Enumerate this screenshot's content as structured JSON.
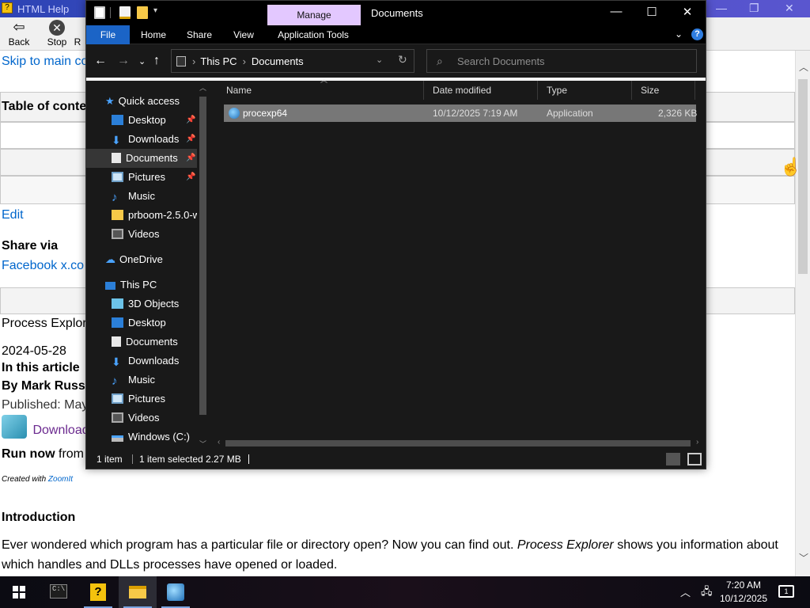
{
  "help_window": {
    "title": "HTML Help",
    "toolbar": {
      "back_label": "Back",
      "stop_label": "Stop",
      "next_partial_label": "R"
    },
    "content": {
      "skip_link": "Skip to main co",
      "toc_heading": "Table of conte",
      "edit_link": "Edit",
      "share_via": "Share via",
      "share_links": "Facebook x.co",
      "article_title": "Process Explor",
      "date": "2024-05-28",
      "in_this_article": "In this article",
      "by_line": "By Mark Russin",
      "published": "Published: May",
      "download_link": "Download",
      "run_now": "Run now",
      "run_now_suffix": "from",
      "created_with": "Created with",
      "zoomit": "ZoomIt",
      "intro_heading": "Introduction",
      "intro_line1_a": "Ever wondered which program has a particular file or directory open? Now you can find out.",
      "intro_line1_em": "Process Explorer",
      "intro_line1_b": "shows you information about",
      "intro_line2": "which handles and DLLs processes have opened or loaded."
    }
  },
  "explorer": {
    "context_tab": "Manage",
    "window_title": "Documents",
    "ribbon_tabs": [
      "File",
      "Home",
      "Share",
      "View",
      "Application Tools"
    ],
    "address": {
      "crumb1": "This PC",
      "crumb2": "Documents"
    },
    "search": {
      "placeholder": "Search Documents",
      "value": ""
    },
    "nav": {
      "quick_access": "Quick access",
      "quick_items": [
        "Desktop",
        "Downloads",
        "Documents",
        "Pictures",
        "Music",
        "prboom-2.5.0-w",
        "Videos"
      ],
      "onedrive": "OneDrive",
      "this_pc": "This PC",
      "pc_items": [
        "3D Objects",
        "Desktop",
        "Documents",
        "Downloads",
        "Music",
        "Pictures",
        "Videos",
        "Windows (C:)"
      ],
      "selected": "Documents"
    },
    "columns": [
      "Name",
      "Date modified",
      "Type",
      "Size"
    ],
    "files": [
      {
        "name": "procexp64",
        "date": "10/12/2025 7:19 AM",
        "type": "Application",
        "size": "2,326 KB",
        "selected": true
      }
    ],
    "status": {
      "count": "1 item",
      "selection": "1 item selected  2.27 MB"
    }
  },
  "taskbar": {
    "time": "7:20 AM",
    "date": "10/12/2025"
  },
  "colors": {
    "accent": "#1b64c6",
    "manage_tab": "#e3c8ff",
    "selected_row": "#777777",
    "link": "#0066cc"
  }
}
